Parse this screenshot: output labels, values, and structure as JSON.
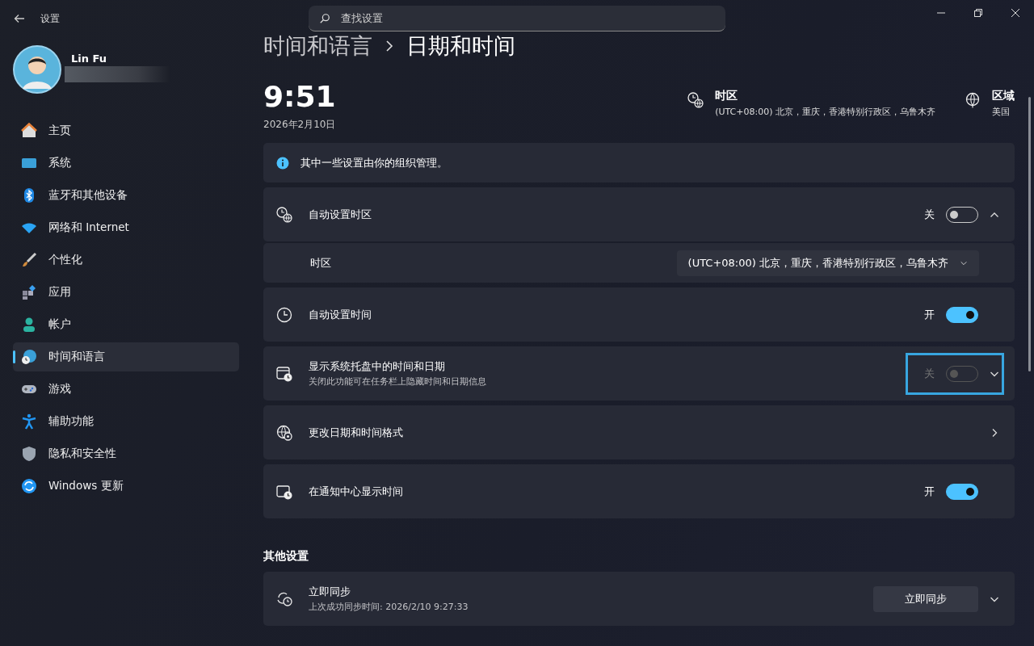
{
  "window": {
    "title": "设置"
  },
  "search": {
    "placeholder": "查找设置"
  },
  "user": {
    "name": "Lin Fu"
  },
  "nav": [
    {
      "label": "主页",
      "selected": false
    },
    {
      "label": "系统",
      "selected": false
    },
    {
      "label": "蓝牙和其他设备",
      "selected": false
    },
    {
      "label": "网络和 Internet",
      "selected": false
    },
    {
      "label": "个性化",
      "selected": false
    },
    {
      "label": "应用",
      "selected": false
    },
    {
      "label": "帐户",
      "selected": false
    },
    {
      "label": "时间和语言",
      "selected": true
    },
    {
      "label": "游戏",
      "selected": false
    },
    {
      "label": "辅助功能",
      "selected": false
    },
    {
      "label": "隐私和安全性",
      "selected": false
    },
    {
      "label": "Windows 更新",
      "selected": false
    }
  ],
  "breadcrumb": [
    "时间和语言",
    "日期和时间"
  ],
  "clock": {
    "time": "9:51",
    "date": "2026年2月10日"
  },
  "summary": [
    {
      "label": "时区",
      "value": "(UTC+08:00) 北京，重庆，香港特别行政区，乌鲁木齐"
    },
    {
      "label": "区域",
      "value": "美国"
    }
  ],
  "notice": "其中一些设置由你的组织管理。",
  "settings": [
    {
      "kind": "toggle",
      "title": "自动设置时区",
      "state_label": "关",
      "on": false,
      "disabled": false,
      "expanded": true,
      "children": [
        {
          "title": "时区",
          "value": "(UTC+08:00) 北京，重庆，香港特别行政区，乌鲁木齐"
        }
      ]
    },
    {
      "kind": "toggle",
      "title": "自动设置时间",
      "state_label": "开",
      "on": true,
      "disabled": false
    },
    {
      "kind": "toggle",
      "title": "显示系统托盘中的时间和日期",
      "subtitle": "关闭此功能可在任务栏上隐藏时间和日期信息",
      "state_label": "关",
      "on": false,
      "disabled": true,
      "expanded": false,
      "highlighted": true
    },
    {
      "kind": "link",
      "title": "更改日期和时间格式"
    },
    {
      "kind": "toggle",
      "title": "在通知中心显示时间",
      "state_label": "开",
      "on": true,
      "disabled": false
    }
  ],
  "other": {
    "heading": "其他设置",
    "rows": [
      {
        "kind": "button",
        "title": "立即同步",
        "subtitle": "上次成功同步时间: 2026/2/10 9:27:33",
        "button": "立即同步",
        "expanded": false
      }
    ]
  }
}
